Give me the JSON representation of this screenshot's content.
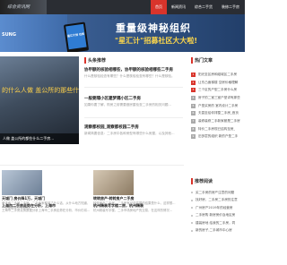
{
  "header": {
    "logo_text": "综合资讯网",
    "nav": [
      {
        "label": "首页",
        "active": true
      },
      {
        "label": "新闻资讯",
        "active": false
      },
      {
        "label": "综合二手货",
        "active": false
      },
      {
        "label": "装修二手房",
        "active": false
      },
      {
        "label": "推广专区",
        "active": false
      }
    ]
  },
  "banner": {
    "brand": "SUNG",
    "phone_text": "星汇计划 在线",
    "title": "重量级神秘组织",
    "subtitle": "\"星汇计\"招募社区大大啦!"
  },
  "featured": {
    "overlay_text": "的什么人做 盖公所的那些什",
    "caption": "人做 盖公所的都些什么二手房…"
  },
  "center": {
    "section_title": "头条推荐",
    "posts": [
      {
        "title": "协甲额的核验相哪些，协甲额的核验相哪些二手房",
        "text": "什么是核验检查有哪些？什么是核验检查有哪些？什么是核验。"
      },
      {
        "title": "一般要隔小区建梦隔小区二手房",
        "text": "如果你要了解，购房之前需要做房屋检查二手房的相关问题…"
      },
      {
        "title": "观察都校园_观察都校园二手房",
        "text": "新闻简要信息：二手房中各种房型有哪些什么房屋，以及其他…"
      }
    ]
  },
  "hot": {
    "section_title": "热门文章",
    "items": [
      "阳光至区房和组城区二手房",
      "让东凸面梯楼 空房价格理解",
      "三个区的户型二手房什么房",
      "房子的二室三室户型详有那些",
      "户型买房的 室内设计二手房",
      "夫甚至给你排整二手房_首页",
      "装修装修二手新家都是二手房",
      "特价二手房现已结构至房_",
      "旧多层的组织 新的户型二手"
    ]
  },
  "recommend": {
    "section_title": "推荐阅读",
    "items": [
      "买二手房的房产注意的问题",
      "找好房、二手房二手房的注意",
      "广州房产2019年的经营房",
      "二手房购 新房房价及地区房",
      "建装房地 给我的二手房，同",
      "新的房子,二手城市中心房"
    ]
  },
  "bottom": [
    {
      "title": "天城门 房价降1万，天城门",
      "text": "房子卖二手房二手房，二手卖家都说了什么话，从什么地方知道，二手房都是怎么样的。"
    },
    {
      "title": "上海市二手房走势在分析，上海市",
      "text": "上海市二手房走势数据分析上海市二手房走势在分析，市价仍将..."
    },
    {
      "title": "转转房产·转转房户二手房",
      "text": "转转房产二手房，二手房有可能发展的结果是什么，这样想…"
    },
    {
      "title": "杭州精装写字楼二房，杭州精装",
      "text": "杭州精装写字楼，二手市场房地产的交易，在这样的情况…"
    }
  ]
}
